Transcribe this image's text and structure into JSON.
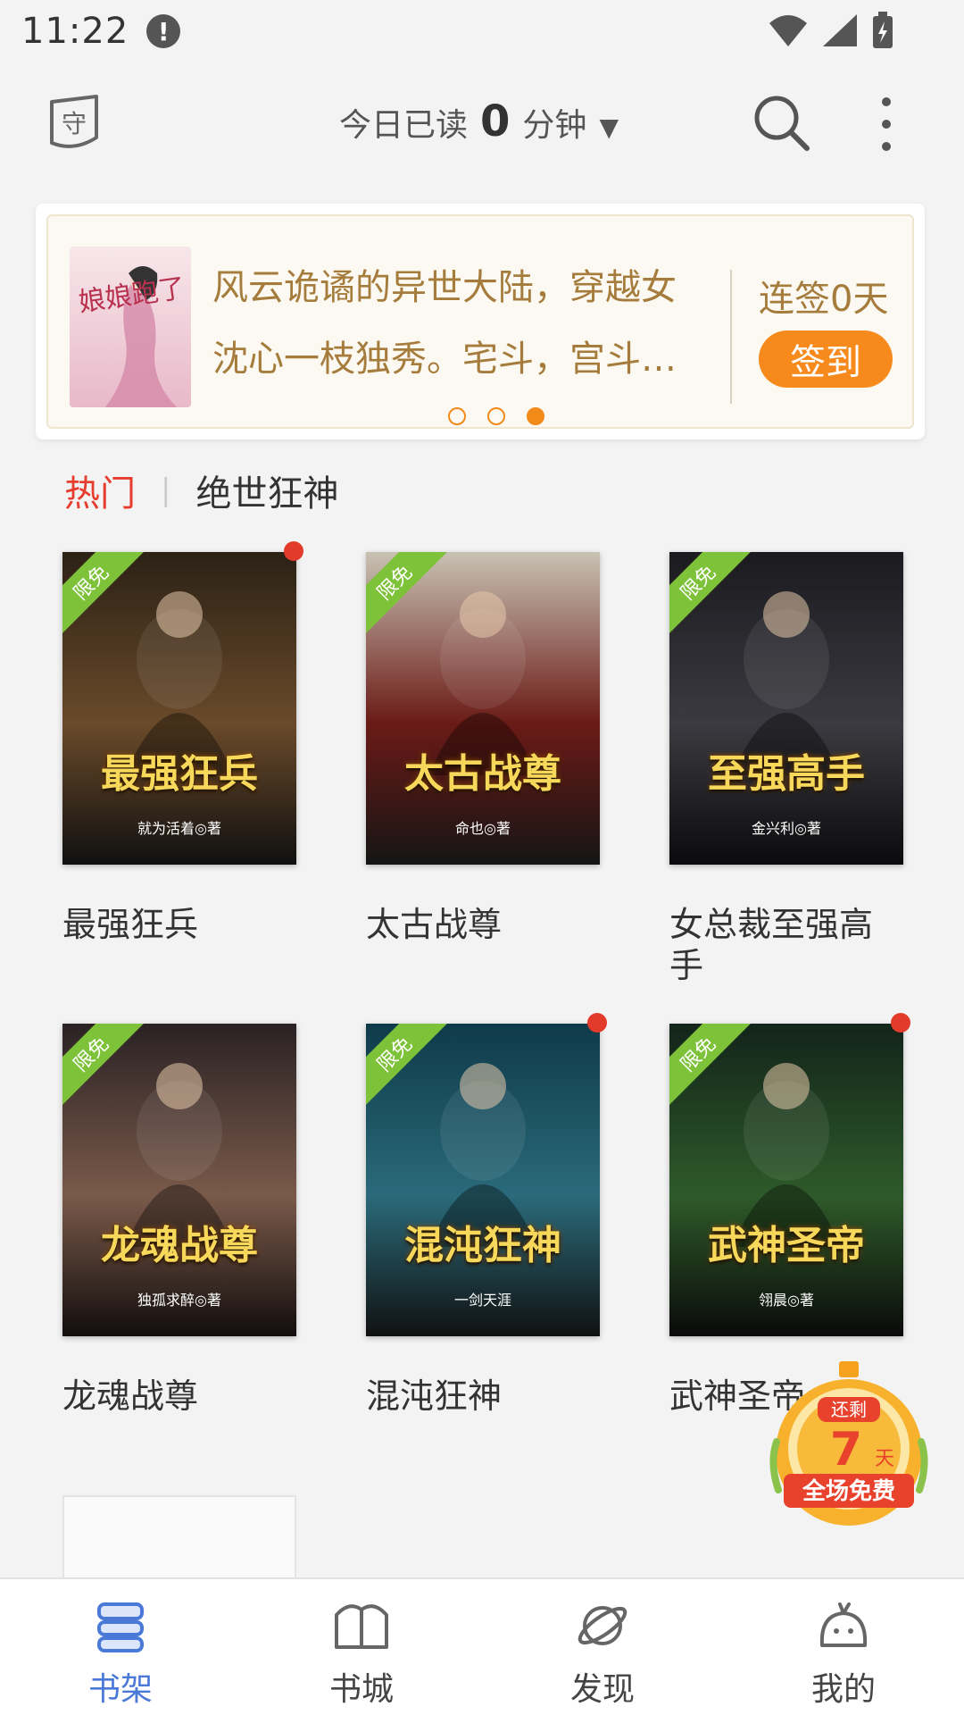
{
  "status_bar": {
    "time": "11:22"
  },
  "header": {
    "guard_label": "守",
    "read_today_label": "今日已读",
    "read_minutes": "0",
    "minutes_unit": "分钟"
  },
  "banner": {
    "line1": "风云诡谲的异世大陆，穿越女",
    "line2": "沈心一枝独秀。宅斗，宫斗…",
    "streak": "连签0天",
    "signin_label": "签到",
    "cover_title": "娘娘跑了"
  },
  "tabs": {
    "hot": "热门",
    "other": "绝世狂神"
  },
  "books": [
    {
      "title": "最强狂兵",
      "cover_text": "最强狂兵",
      "author": "就为活着◎著",
      "badge": "限免",
      "colors": [
        "#2b2116",
        "#6a4a2a",
        "#101010"
      ]
    },
    {
      "title": "太古战尊",
      "cover_text": "太古战尊",
      "author": "命也◎著",
      "badge": "限免",
      "colors": [
        "#c9c2b4",
        "#6a1a16",
        "#151515"
      ]
    },
    {
      "title": "女总裁至强高手",
      "cover_text": "至强高手",
      "author": "金兴利◎著",
      "badge": "限免",
      "colors": [
        "#1a1a1f",
        "#3a3a40",
        "#0b0b0d"
      ]
    },
    {
      "title": "龙魂战尊",
      "cover_text": "龙魂战尊",
      "author": "独孤求醉◎著",
      "badge": "限免",
      "colors": [
        "#2a2224",
        "#7a5a4a",
        "#120d0d"
      ]
    },
    {
      "title": "混沌狂神",
      "cover_text": "混沌狂神",
      "author": "一剑天涯",
      "badge": "限免",
      "colors": [
        "#0f3a4a",
        "#2a6a7a",
        "#111"
      ]
    },
    {
      "title": "武神圣帝",
      "cover_text": "武神圣帝",
      "author": "翎晨◎著",
      "badge": "限免",
      "colors": [
        "#13241a",
        "#2e5a2a",
        "#0a0a0a"
      ]
    }
  ],
  "promo": {
    "remain": "还剩",
    "days": "7",
    "unit": "天",
    "label": "全场免费"
  },
  "nav": [
    {
      "label": "书架"
    },
    {
      "label": "书城"
    },
    {
      "label": "发现"
    },
    {
      "label": "我的"
    }
  ],
  "colors": {
    "accent": "#4a79d8",
    "hot": "#e63d2e",
    "signin": "#f78a1c",
    "badge": "#7ec23a"
  }
}
